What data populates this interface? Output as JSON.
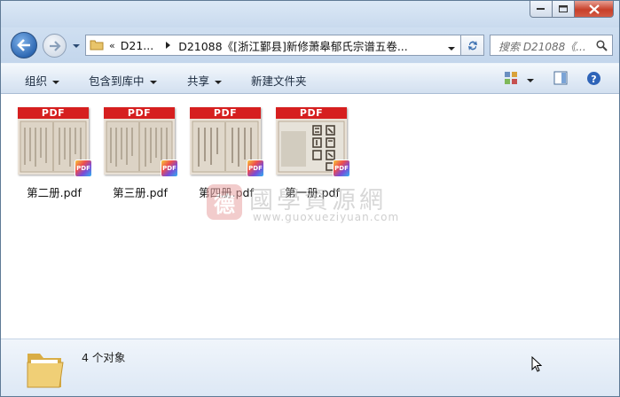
{
  "window": {
    "controls": {
      "minimize": "minimize",
      "maximize": "maximize",
      "close": "close"
    }
  },
  "address": {
    "crumbs": [
      "D21...",
      "D21088《[浙江鄞县]新修萧皋郁氏宗谱五卷..."
    ],
    "separator": "«",
    "search_placeholder": "搜索 D21088《..."
  },
  "toolbar": {
    "organize": "组织",
    "include_library": "包含到库中",
    "share": "共享",
    "new_folder": "新建文件夹"
  },
  "files": [
    {
      "name": "第二册.pdf",
      "banner": "PDF"
    },
    {
      "name": "第三册.pdf",
      "banner": "PDF"
    },
    {
      "name": "第四册.pdf",
      "banner": "PDF"
    },
    {
      "name": "第一册.pdf",
      "banner": "PDF"
    }
  ],
  "watermark": {
    "seal": "德",
    "name": "國學資源網",
    "url": "www.guoxueziyuan.com"
  },
  "status": {
    "count_text": "4 个对象"
  },
  "colors": {
    "pdf_banner": "#d61f1f",
    "titlebar": "#dbe8f6",
    "close_button": "#c7402a"
  },
  "icons": {
    "back": "back-arrow-icon",
    "forward": "forward-arrow-icon",
    "folder": "folder-icon",
    "refresh": "refresh-icon",
    "search": "search-icon",
    "view": "view-options-icon",
    "preview_pane": "preview-pane-icon",
    "help": "help-icon"
  }
}
